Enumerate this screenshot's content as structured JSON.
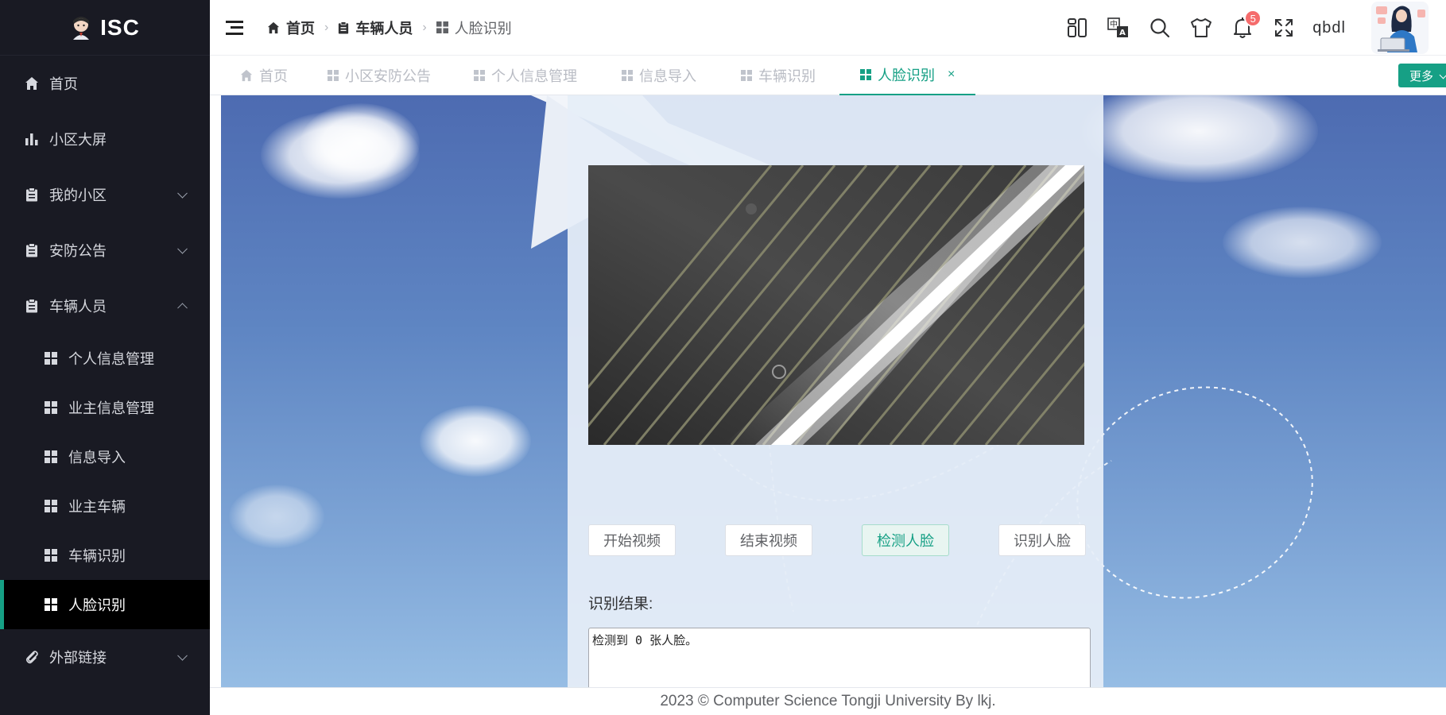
{
  "app": {
    "logo_text": "ISC"
  },
  "sidebar": {
    "items": [
      {
        "label": "首页",
        "icon": "home-icon"
      },
      {
        "label": "小区大屏",
        "icon": "bar-chart-icon"
      },
      {
        "label": "我的小区",
        "icon": "clipboard-icon",
        "expanded": false
      },
      {
        "label": "安防公告",
        "icon": "clipboard-icon",
        "expanded": false
      },
      {
        "label": "车辆人员",
        "icon": "clipboard-icon",
        "expanded": true
      },
      {
        "label": "外部链接",
        "icon": "paperclip-icon",
        "expanded": false
      }
    ],
    "subitems": [
      {
        "label": "个人信息管理"
      },
      {
        "label": "业主信息管理"
      },
      {
        "label": "信息导入"
      },
      {
        "label": "业主车辆"
      },
      {
        "label": "车辆识别"
      },
      {
        "label": "人脸识别",
        "active": true
      }
    ]
  },
  "header": {
    "breadcrumb": [
      "首页",
      "车辆人员",
      "人脸识别"
    ],
    "notification_count": "5",
    "username": "qbdl"
  },
  "tabs": {
    "items": [
      "首页",
      "小区安防公告",
      "个人信息管理",
      "信息导入",
      "车辆识别",
      "人脸识别"
    ],
    "active_index": 5,
    "close_glyph": "×",
    "more_label": "更多"
  },
  "face": {
    "buttons": [
      "开始视频",
      "结束视频",
      "检测人脸",
      "识别人脸"
    ],
    "result_label": "识别结果:",
    "result_text": "检测到 0 张人脸。"
  },
  "footer": {
    "text": "2023 © Computer Science Tongji University By lkj."
  },
  "colors": {
    "accent": "#16a085",
    "sidebar_bg": "#191a23",
    "badge": "#f56c6c"
  }
}
